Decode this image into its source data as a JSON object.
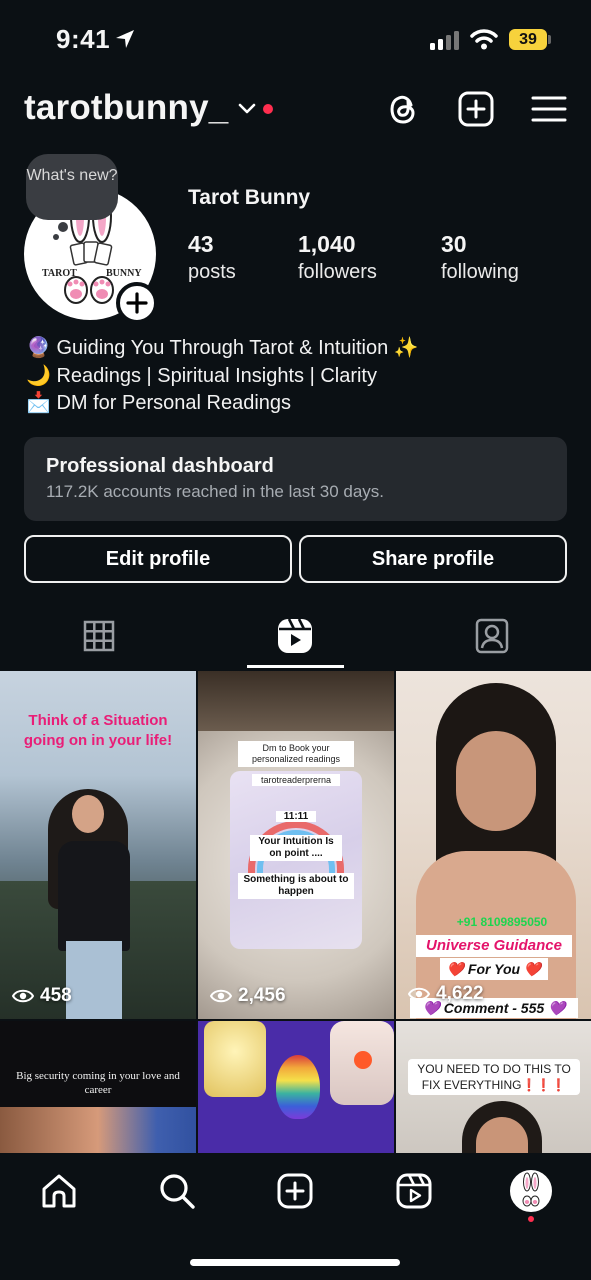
{
  "status_bar": {
    "time": "9:41",
    "battery": "39"
  },
  "header": {
    "username": "tarotbunny_"
  },
  "profile": {
    "whats_new": "What's new?",
    "avatar_text_left": "TAROT",
    "avatar_text_right": "BUNNY",
    "display_name": "Tarot Bunny",
    "posts_count": "43",
    "posts_label": "posts",
    "followers_count": "1,040",
    "followers_label": "followers",
    "following_count": "30",
    "following_label": "following",
    "bio": [
      "🔮 Guiding You Through Tarot & Intuition ✨",
      "🌙 Readings | Spiritual Insights | Clarity",
      "📩 DM for Personal Readings"
    ]
  },
  "dashboard": {
    "title": "Professional dashboard",
    "subtitle": "117.2K accounts reached in the last 30 days."
  },
  "buttons": {
    "edit": "Edit profile",
    "share": "Share profile"
  },
  "grid": {
    "r1c1_caption": "Think of a Situation going on in your life!",
    "r1c1_views": "458",
    "r1c2_top": "Dm to Book your personalized readings",
    "r1c2_handle": "tarotreaderprerna",
    "r1c2_time": "11:11",
    "r1c2_line1": "Your Intuition Is on point ....",
    "r1c2_line2": "Something is about to happen",
    "r1c2_views": "2,456",
    "r1c3_phone": "+91 8109895050",
    "r1c3_title1": "Universe Guidance",
    "r1c3_title2": "❤️ For You ❤️",
    "r1c3_comment": "💜 Comment - 555 💜",
    "r1c3_views": "4,622",
    "r2c1_caption": "Big security coming in your love and career",
    "r2c3_caption": "YOU NEED TO DO THIS TO FIX EVERYTHING❗❗❗"
  }
}
